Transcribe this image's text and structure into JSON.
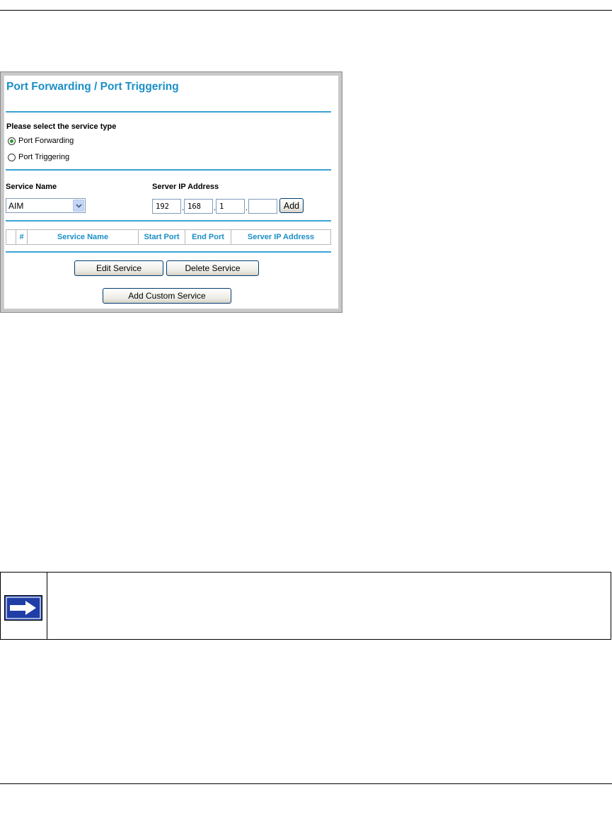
{
  "panel": {
    "title": "Port Forwarding / Port Triggering",
    "service_type_label": "Please select the service type",
    "service_types": [
      {
        "label": "Port Forwarding",
        "selected": true
      },
      {
        "label": "Port Triggering",
        "selected": false
      }
    ],
    "service_name_label": "Service Name",
    "service_name_value": "AIM",
    "server_ip_label": "Server IP Address",
    "server_ip": [
      "192",
      "168",
      "1",
      ""
    ],
    "add_label": "Add",
    "table_headers": [
      "",
      "#",
      "Service Name",
      "Start Port",
      "End Port",
      "Server IP Address"
    ],
    "edit_label": "Edit Service",
    "delete_label": "Delete Service",
    "add_custom_label": "Add Custom Service"
  },
  "colors": {
    "accent": "#1b8fc7",
    "rule": "#3ba3d4",
    "radio_dot": "#2a9a2a",
    "note_arrow": "#1f3fa6"
  },
  "icons": {
    "note": "right-arrow-icon",
    "dropdown": "chevron-down-icon"
  }
}
